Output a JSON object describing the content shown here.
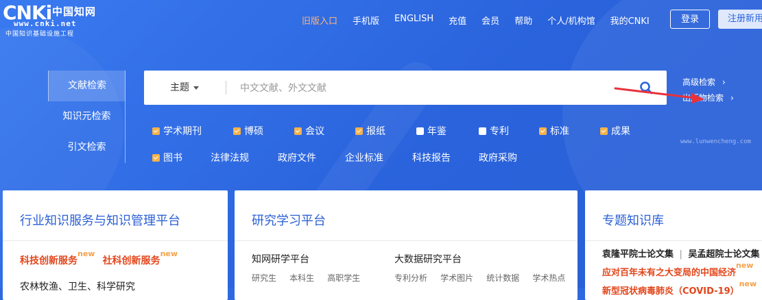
{
  "logo": {
    "brand": "CNKi",
    "brand_cn": "中国知网",
    "url": "www.cnki.net",
    "subtitle": "中国知识基础设施工程"
  },
  "nav": {
    "items": [
      "旧版入口",
      "手机版",
      "ENGLISH",
      "充值",
      "会员",
      "帮助",
      "个人/机构馆",
      "我的CNKI"
    ],
    "active_index": 0,
    "login": "登录",
    "register": "注册新用户"
  },
  "search_tabs": [
    "文献检索",
    "知识元检索",
    "引文检索"
  ],
  "search": {
    "field": "主题",
    "placeholder": "中文文献、外文文献"
  },
  "side_links": {
    "advanced": "高级检索",
    "publication": "出版物检索"
  },
  "watermark": "www.lunwencheng.com",
  "checkboxes_row1": [
    {
      "label": "学术期刊",
      "checked": true
    },
    {
      "label": "博硕",
      "checked": true
    },
    {
      "label": "会议",
      "checked": true
    },
    {
      "label": "报纸",
      "checked": true
    },
    {
      "label": "年鉴",
      "checked": false
    },
    {
      "label": "专利",
      "checked": false
    },
    {
      "label": "标准",
      "checked": true
    },
    {
      "label": "成果",
      "checked": true
    }
  ],
  "row2": {
    "book": {
      "label": "图书",
      "checked": true
    },
    "plain": [
      "法律法规",
      "政府文件",
      "企业标准",
      "科技报告",
      "政府采购"
    ]
  },
  "cards": {
    "industry": {
      "title": "行业知识服务与知识管理平台",
      "hot1": "科技创新服务",
      "hot2": "社科创新服务",
      "new": "new",
      "line": "农林牧渔、卫生、科学研究"
    },
    "research": {
      "title": "研究学习平台",
      "col1_title": "知网研学平台",
      "col1_items": [
        "研究生",
        "本科生",
        "高职学生"
      ],
      "col2_title": "大数据研究平台",
      "col2_items": [
        "专利分析",
        "学术图片",
        "统计数据",
        "学术热点"
      ]
    },
    "topic": {
      "title": "专题知识库",
      "line1a": "袁隆平院士论文集",
      "line1b": "吴孟超院士论文集",
      "line2": "应对百年未有之大变局的中国经济",
      "line3": "新型冠状病毒肺炎（COVID-19）",
      "new": "new"
    }
  },
  "colors": {
    "hero_blue": "#2a63dc",
    "accent_orange": "#f7b24a",
    "hot_red": "#e2461b",
    "nav_active": "#ffb377",
    "arrow_red": "#e8323c"
  }
}
